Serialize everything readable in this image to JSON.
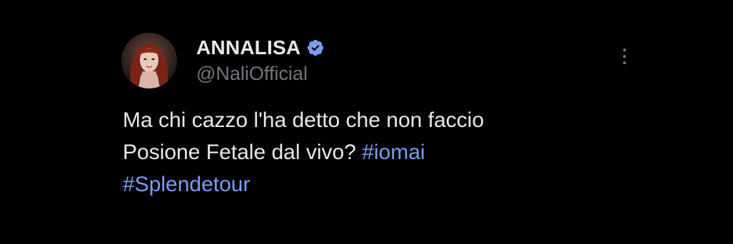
{
  "tweet": {
    "author": {
      "display_name": "ANNALISA",
      "handle": "@NaliOfficial",
      "verified": true,
      "avatar_icon": "avatar-photo"
    },
    "text_line1": "Ma chi cazzo l'ha detto che non faccio",
    "text_line2_plain": "Posione Fetale dal vivo? ",
    "hashtags": [
      "#iomai",
      "#Splendetour"
    ],
    "more_icon": "more-vertical-icon"
  },
  "colors": {
    "background": "#000000",
    "text": "#e7e9ea",
    "secondary_text": "#71767b",
    "hashtag": "#7c9cf0",
    "verified_badge": "#7c9cf0"
  }
}
